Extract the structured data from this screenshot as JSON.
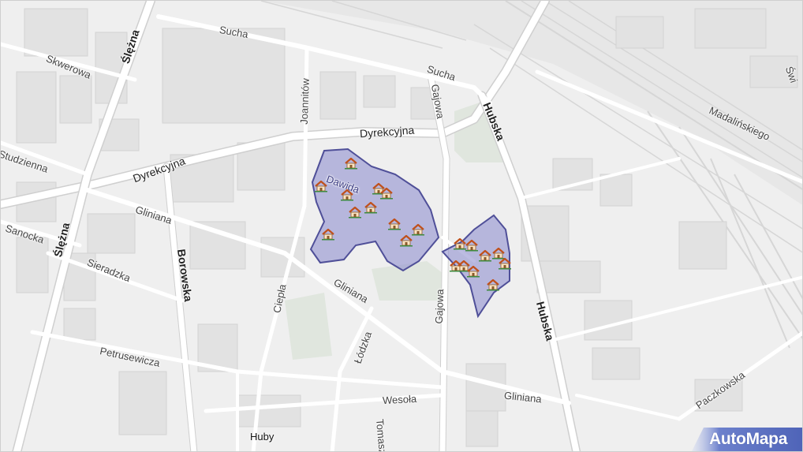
{
  "map": {
    "streets": [
      {
        "id": "sucha-1",
        "name": "Sucha",
        "kind": "normal"
      },
      {
        "id": "sucha-2",
        "name": "Sucha",
        "kind": "normal"
      },
      {
        "id": "sleza-1",
        "name": "Ślężna",
        "kind": "bold"
      },
      {
        "id": "sleza-2",
        "name": "Ślężna",
        "kind": "bold"
      },
      {
        "id": "skwerowa",
        "name": "Skwerowa",
        "kind": "normal"
      },
      {
        "id": "joannitow",
        "name": "Joannitów",
        "kind": "normal"
      },
      {
        "id": "gajowa-1",
        "name": "Gajowa",
        "kind": "normal"
      },
      {
        "id": "gajowa-2",
        "name": "Gajowa",
        "kind": "normal"
      },
      {
        "id": "hubska-1",
        "name": "Hubska",
        "kind": "bold"
      },
      {
        "id": "hubska-2",
        "name": "Hubska",
        "kind": "bold"
      },
      {
        "id": "dyrekcyjna-1",
        "name": "Dyrekcyjna",
        "kind": "major"
      },
      {
        "id": "dyrekcyjna-2",
        "name": "Dyrekcyjna",
        "kind": "major"
      },
      {
        "id": "madalinskiego",
        "name": "Madalińskiego",
        "kind": "normal"
      },
      {
        "id": "swi",
        "name": "Świ",
        "kind": "normal"
      },
      {
        "id": "studzienna",
        "name": "Studzienna",
        "kind": "normal"
      },
      {
        "id": "sanocka",
        "name": "Sanocka",
        "kind": "normal"
      },
      {
        "id": "gliniana-1",
        "name": "Gliniana",
        "kind": "normal"
      },
      {
        "id": "gliniana-2",
        "name": "Gliniana",
        "kind": "normal"
      },
      {
        "id": "gliniana-3",
        "name": "Gliniana",
        "kind": "normal"
      },
      {
        "id": "borowska",
        "name": "Borowska",
        "kind": "bold"
      },
      {
        "id": "sieradzka",
        "name": "Sieradzka",
        "kind": "normal"
      },
      {
        "id": "ciepla",
        "name": "Ciepła",
        "kind": "normal"
      },
      {
        "id": "petrusewicza",
        "name": "Petrusewicza",
        "kind": "normal"
      },
      {
        "id": "lodzka",
        "name": "Łódzka",
        "kind": "normal"
      },
      {
        "id": "wesola",
        "name": "Wesoła",
        "kind": "normal"
      },
      {
        "id": "tomasz",
        "name": "Tomasz",
        "kind": "normal"
      },
      {
        "id": "paczkowska",
        "name": "Paczkowska",
        "kind": "normal"
      }
    ],
    "area_label": "Dawida",
    "place_label": "Huby",
    "highlight_color": "#8f8fcf",
    "highlight_border": "#4f4f98",
    "houses_count": 20,
    "logo": {
      "text": "AutoMapa",
      "color": "#4f64b8"
    }
  }
}
